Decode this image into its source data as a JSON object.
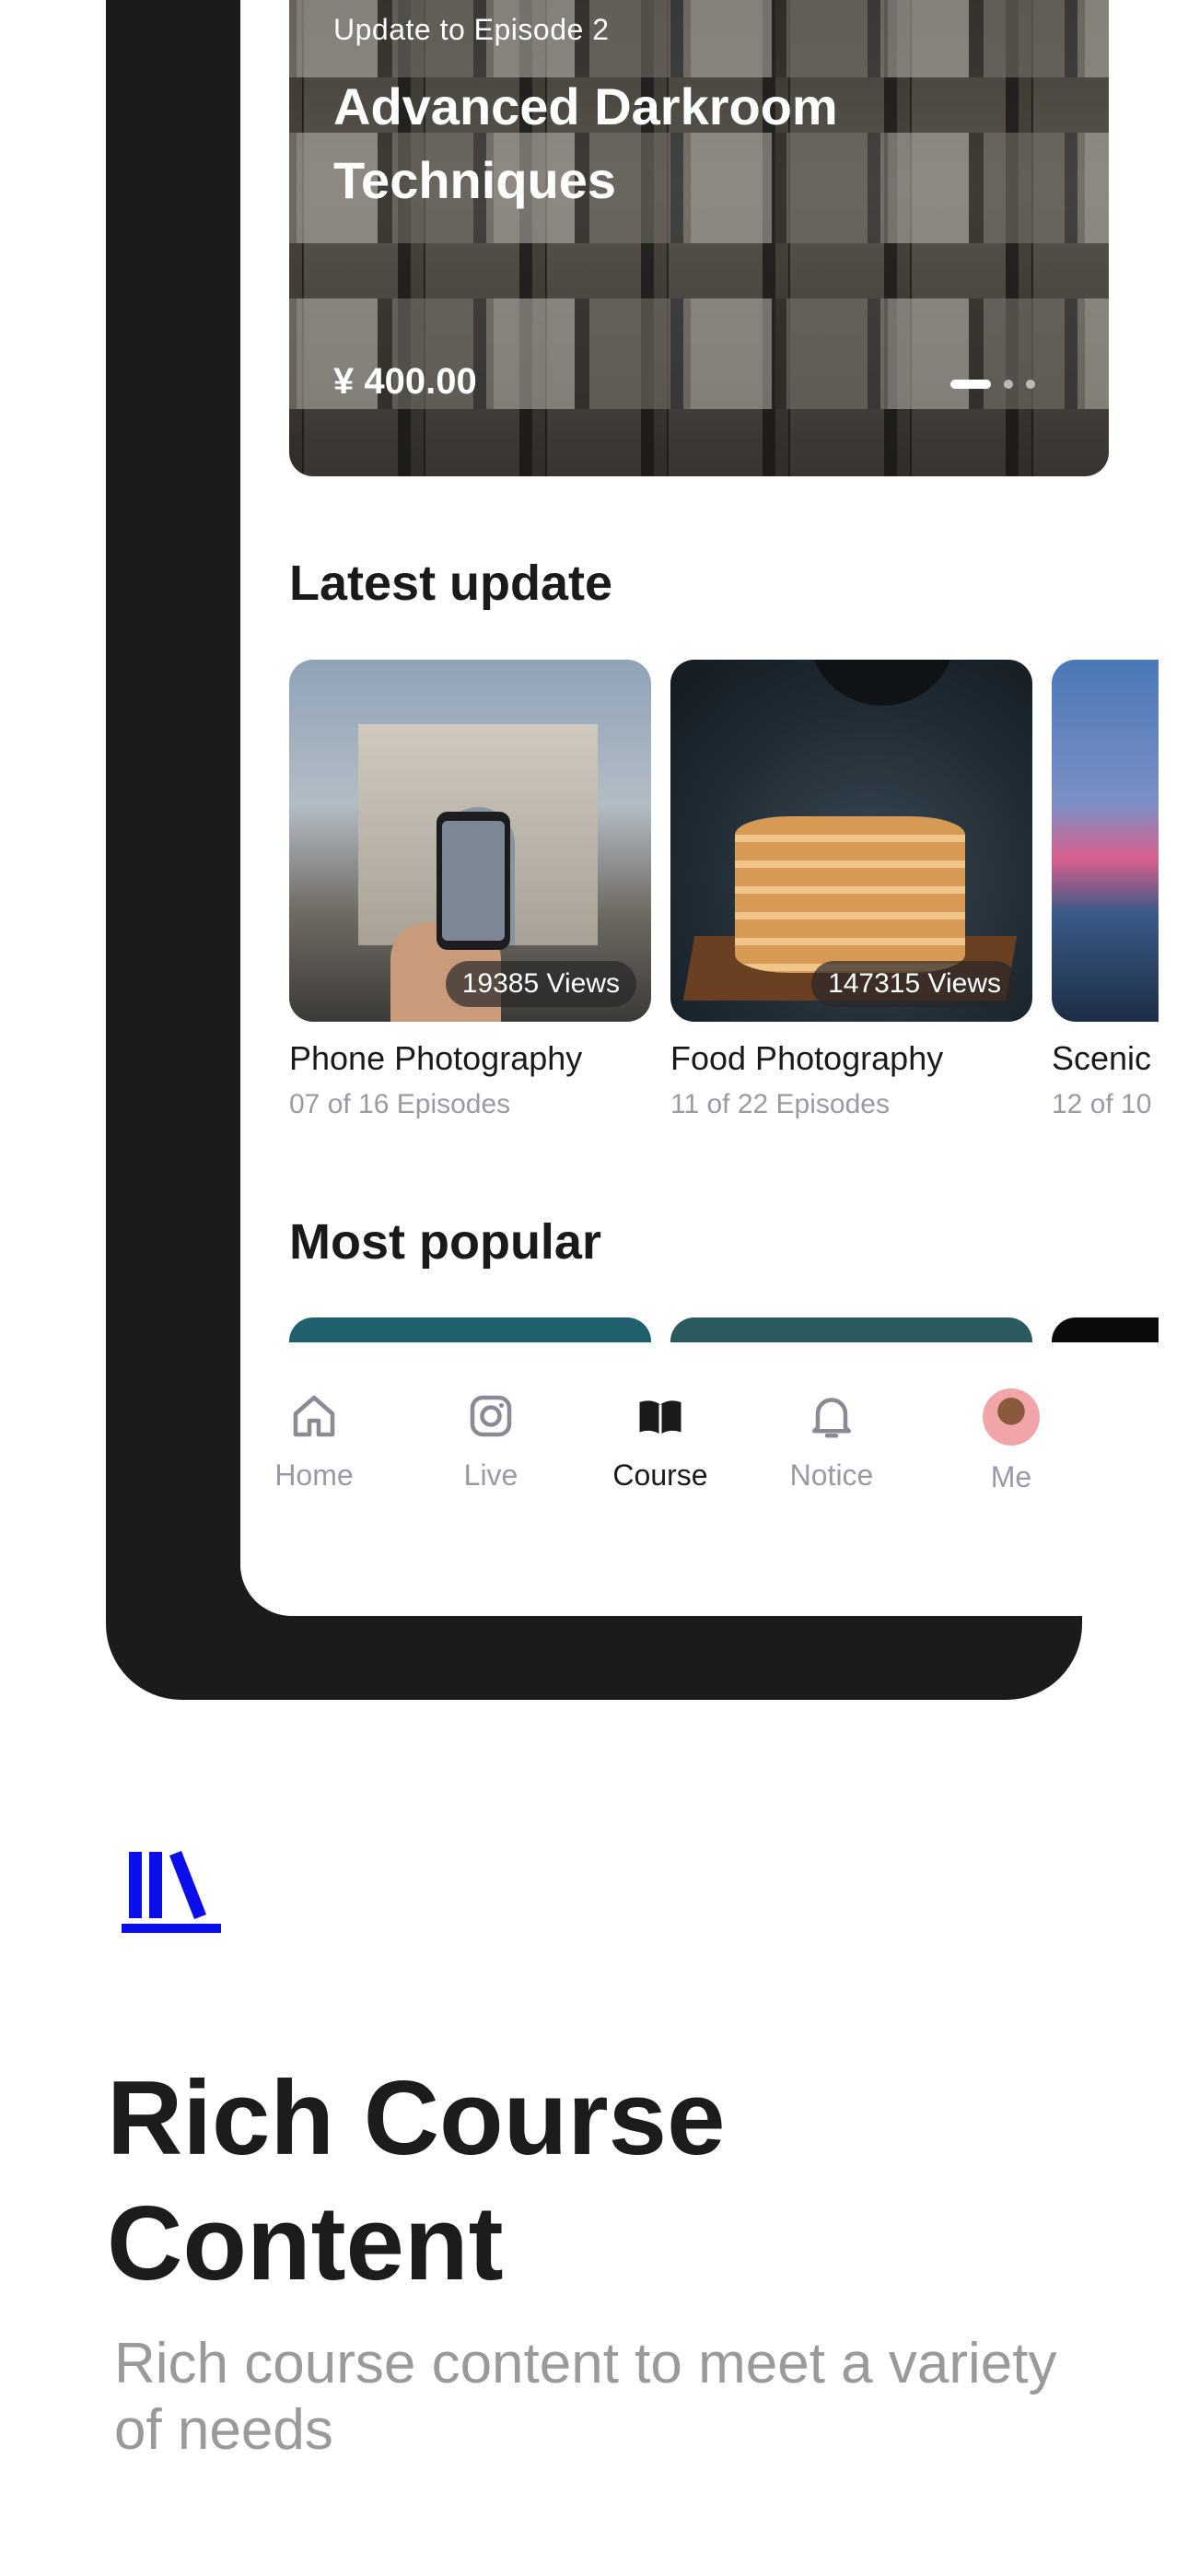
{
  "hero": {
    "subtitle": "Update to Episode 2",
    "title": "Advanced Darkroom Techniques",
    "price": "¥ 400.00",
    "slides": 3,
    "active_slide": 1
  },
  "latest": {
    "heading": "Latest update",
    "cards": [
      {
        "title": "Phone Photography",
        "episodes": "07 of 16 Episodes",
        "views": "19385 Views"
      },
      {
        "title": "Food Photography",
        "episodes": "11 of 22 Episodes",
        "views": "147315 Views"
      },
      {
        "title": "Scenic",
        "episodes": "12 of 10"
      }
    ]
  },
  "popular": {
    "heading": "Most popular"
  },
  "tabbar": {
    "items": [
      {
        "label": "Home",
        "icon": "home-icon",
        "active": false
      },
      {
        "label": "Live",
        "icon": "instagram-icon",
        "active": false
      },
      {
        "label": "Course",
        "icon": "book-icon",
        "active": true
      },
      {
        "label": "Notice",
        "icon": "bell-icon",
        "active": false
      },
      {
        "label": "Me",
        "icon": "avatar",
        "active": false
      }
    ]
  },
  "promo": {
    "logo": "library-icon",
    "title": "Rich Course Content",
    "description": "Rich course content to meet a variety of needs"
  },
  "colors": {
    "accent_blue": "#0a0ee8",
    "text_dark": "#1a1a1a",
    "text_muted": "#9a9aa4",
    "phone_frame": "#1b1b1b"
  }
}
